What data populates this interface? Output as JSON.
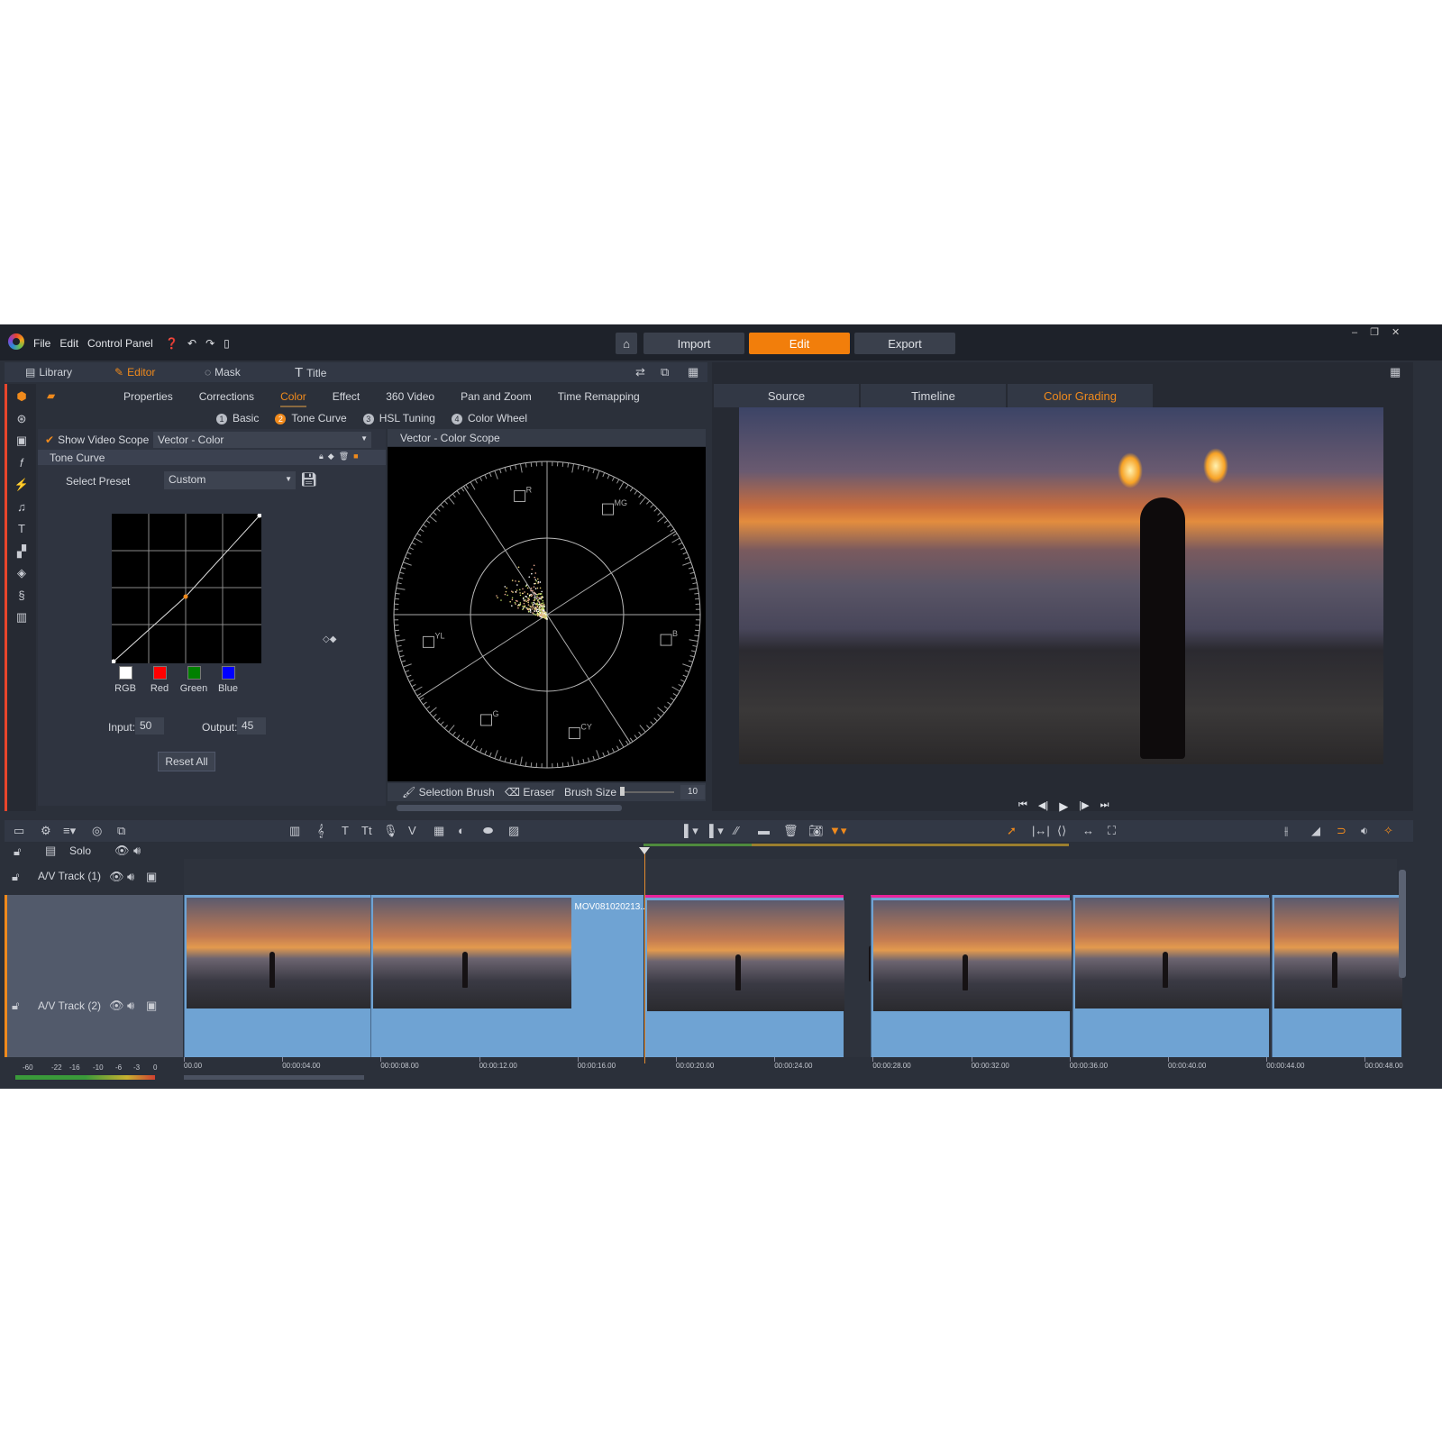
{
  "menu": {
    "items": [
      "File",
      "Edit",
      "Control Panel"
    ],
    "icons": [
      "help-icon",
      "undo-icon",
      "redo-icon",
      "project-icon"
    ]
  },
  "modes": {
    "import": "Import",
    "edit": "Edit",
    "export": "Export",
    "active": "Edit"
  },
  "window_controls": [
    "minimize-icon",
    "restore-icon",
    "close-icon"
  ],
  "editor_tabs": [
    {
      "label": "Library",
      "icon": "library-icon"
    },
    {
      "label": "Editor",
      "icon": "editor-icon",
      "active": true
    },
    {
      "label": "Mask",
      "icon": "mask-icon"
    },
    {
      "label": "Title",
      "icon": "title-icon"
    }
  ],
  "property_tabs": [
    "Properties",
    "Corrections",
    "Color",
    "Effect",
    "360 Video",
    "Pan and Zoom",
    "Time Remapping"
  ],
  "active_property_tab": "Color",
  "color_steps": [
    {
      "n": "1",
      "label": "Basic"
    },
    {
      "n": "2",
      "label": "Tone Curve",
      "active": true
    },
    {
      "n": "3",
      "label": "HSL Tuning"
    },
    {
      "n": "4",
      "label": "Color Wheel"
    }
  ],
  "scope": {
    "show_label": "Show Video Scope",
    "checked": true,
    "selected": "Vector - Color",
    "title": "Vector - Color Scope",
    "targets": [
      "R",
      "MG",
      "B",
      "CY",
      "G",
      "YL"
    ]
  },
  "tone_curve": {
    "header": "Tone Curve",
    "preset_label": "Select Preset",
    "preset_value": "Custom",
    "channels": [
      {
        "label": "RGB",
        "color": "#ffffff"
      },
      {
        "label": "Red",
        "color": "#ff0000"
      },
      {
        "label": "Green",
        "color": "#008000"
      },
      {
        "label": "Blue",
        "color": "#0000ff"
      }
    ],
    "input_label": "Input:",
    "input_value": "50",
    "output_label": "Output:",
    "output_value": "45",
    "reset_label": "Reset All"
  },
  "brush": {
    "selection": "Selection Brush",
    "eraser": "Eraser",
    "size_label": "Brush Size",
    "size_value": "10"
  },
  "preview_tabs": [
    "Source",
    "Timeline",
    "Color Grading"
  ],
  "active_preview_tab": "Color Grading",
  "tracks": {
    "solo": "Solo",
    "track1": "A/V Track (1)",
    "track2": "A/V Track (2)"
  },
  "clips": [
    {
      "start": 0,
      "end": 7.6
    },
    {
      "start": 7.6,
      "end": 18.7,
      "label": "MOV081020213..."
    },
    {
      "start": 18.7,
      "end": 26.8
    },
    {
      "start": 27.9,
      "end": 36.0
    },
    {
      "start": 36.1,
      "end": 44.1
    },
    {
      "start": 44.2,
      "end": 49.5
    }
  ],
  "playhead_seconds": 18.7,
  "ruler": [
    "00.00",
    "00:00:04.00",
    "00:00:08.00",
    "00:00:12.00",
    "00:00:16.00",
    "00:00:20.00",
    "00:00:24.00",
    "00:00:28.00",
    "00:00:32.00",
    "00:00:36.00",
    "00:00:40.00",
    "00:00:44.00",
    "00:00:48.00"
  ],
  "audio_meter": [
    "-60",
    "-22",
    "-16",
    "-10",
    "-6",
    "-3",
    "0"
  ],
  "colors": {
    "accent": "#f27e0b",
    "clip": "#6fa3d3",
    "selection": "#e8239a"
  }
}
